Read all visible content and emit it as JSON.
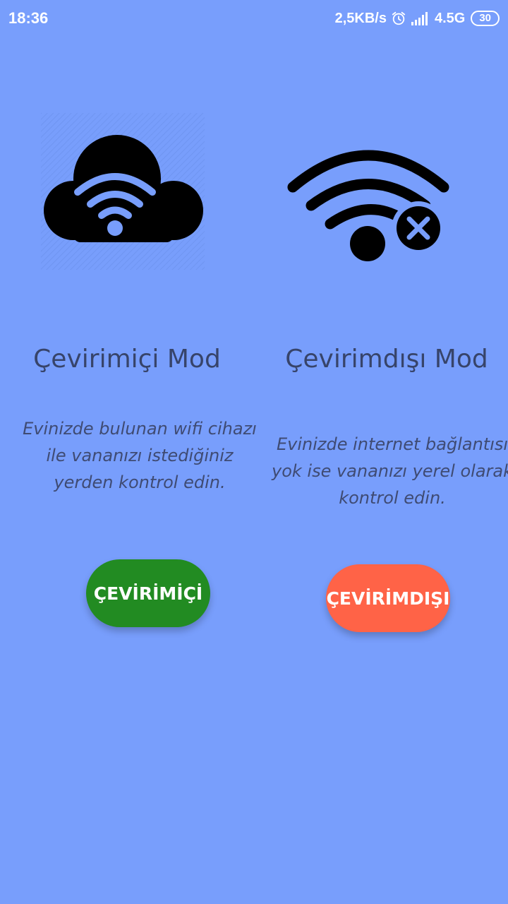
{
  "status_bar": {
    "time": "18:36",
    "network_speed": "2,5KB/s",
    "network_type": "4.5G",
    "battery": "30",
    "icons": [
      "alarm-icon",
      "signal-icon"
    ]
  },
  "online": {
    "icon": "cloud-wifi-icon",
    "title": "Çevirimiçi Mod",
    "description": "Evinizde bulunan wifi cihazı ile vananızı istediğiniz yerden kontrol edin.",
    "button_label": "ÇEVİRİMİÇİ",
    "button_color": "#228b22"
  },
  "offline": {
    "icon": "wifi-off-icon",
    "title": "Çevirimdışı Mod",
    "description": "Evinizde internet bağlantısı yok ise vananızı yerel olarak kontrol edin.",
    "button_label": "ÇEVİRİMDIŞI",
    "button_color": "#ff6347"
  },
  "colors": {
    "background": "#789efc",
    "title_text": "#37446a",
    "description_text": "#3f4b73"
  }
}
